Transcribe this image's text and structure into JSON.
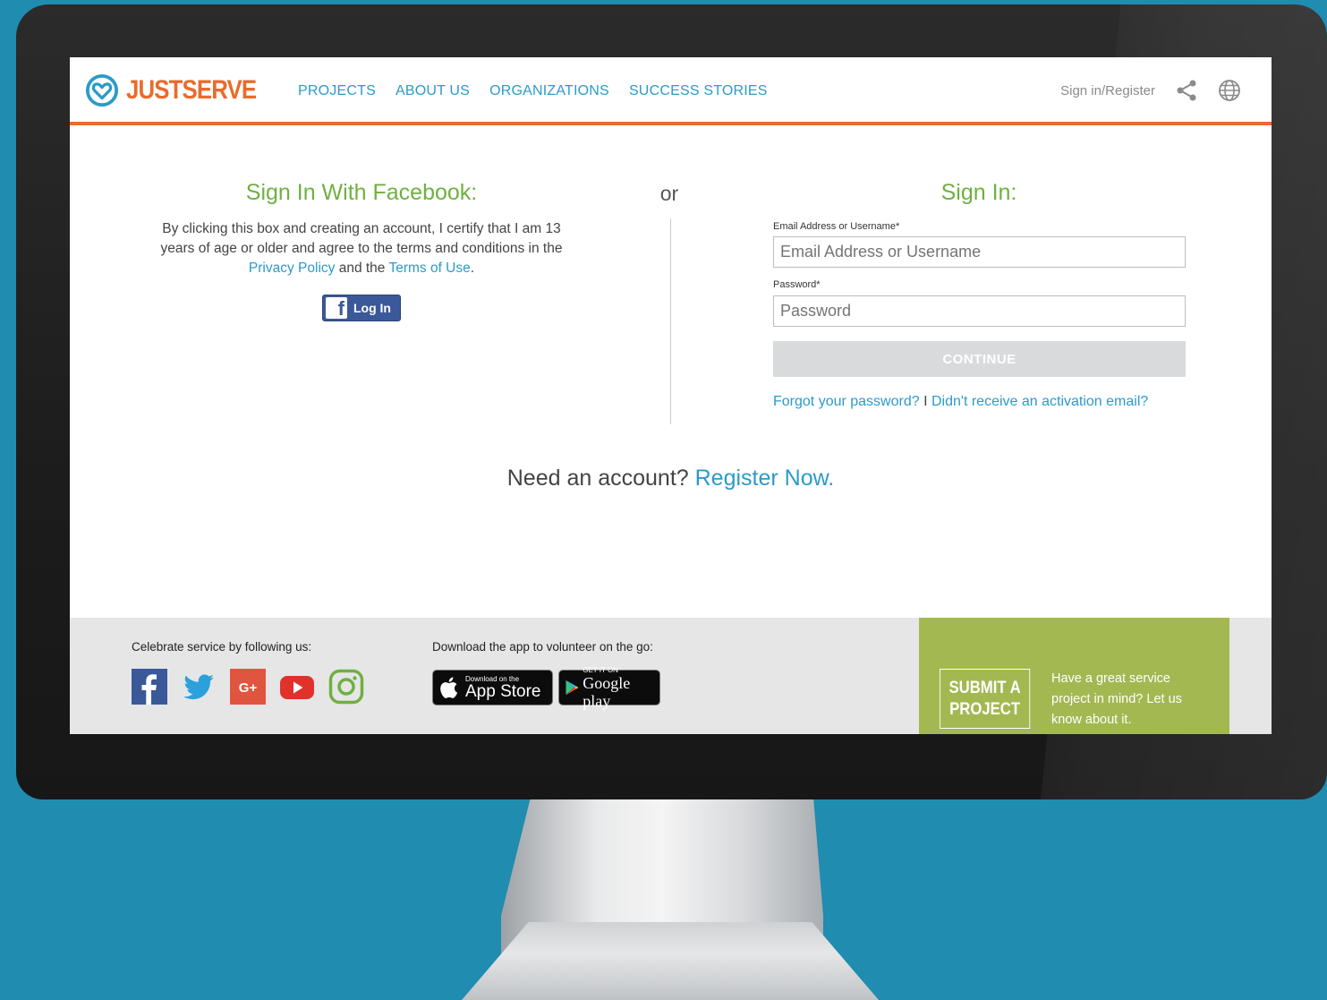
{
  "brand": {
    "just": "JUST",
    "serve": "SERVE"
  },
  "nav": [
    {
      "label": "PROJECTS"
    },
    {
      "label": "ABOUT US"
    },
    {
      "label": "ORGANIZATIONS"
    },
    {
      "label": "SUCCESS STORIES"
    }
  ],
  "header": {
    "signin_register": "Sign in/Register",
    "icons": [
      "share-icon",
      "globe-icon"
    ]
  },
  "facebook_section": {
    "title": "Sign In With Facebook:",
    "text_before": "By clicking this box and creating an account, I certify that I am 13 years of age or older and agree to the terms and conditions in the ",
    "privacy_link": "Privacy Policy",
    "text_middle": " and the ",
    "terms_link": "Terms of Use",
    "text_after": ".",
    "button_label": "Log In"
  },
  "or_label": "or",
  "signin": {
    "title": "Sign In:",
    "email_label": "Email Address or Username*",
    "email_placeholder": "Email Address or Username",
    "password_label": "Password*",
    "password_placeholder": "Password",
    "continue_label": "CONTINUE",
    "forgot_link": "Forgot your password?",
    "separator": " I ",
    "activation_link": "Didn't receive an activation email?"
  },
  "register": {
    "prefix": "Need an account? ",
    "link": "Register Now."
  },
  "footer": {
    "social_caption": "Celebrate service by following us:",
    "social_icons": [
      "facebook-icon",
      "twitter-icon",
      "google-plus-icon",
      "youtube-icon",
      "instagram-icon"
    ],
    "app_caption": "Download the app to volunteer on the go:",
    "app_store": {
      "small": "Download on the",
      "big": "App Store"
    },
    "google_play": {
      "small": "GET IT ON",
      "big": "Google play"
    },
    "submit_button": "SUBMIT A PROJECT",
    "submit_text": "Have a great service project in mind? Let us know about it."
  },
  "colors": {
    "accent_orange": "#e96b2d",
    "link_blue": "#2b9bc9",
    "title_green": "#6fb041",
    "panel_green": "#a3b851",
    "background": "#1f8cb0"
  }
}
